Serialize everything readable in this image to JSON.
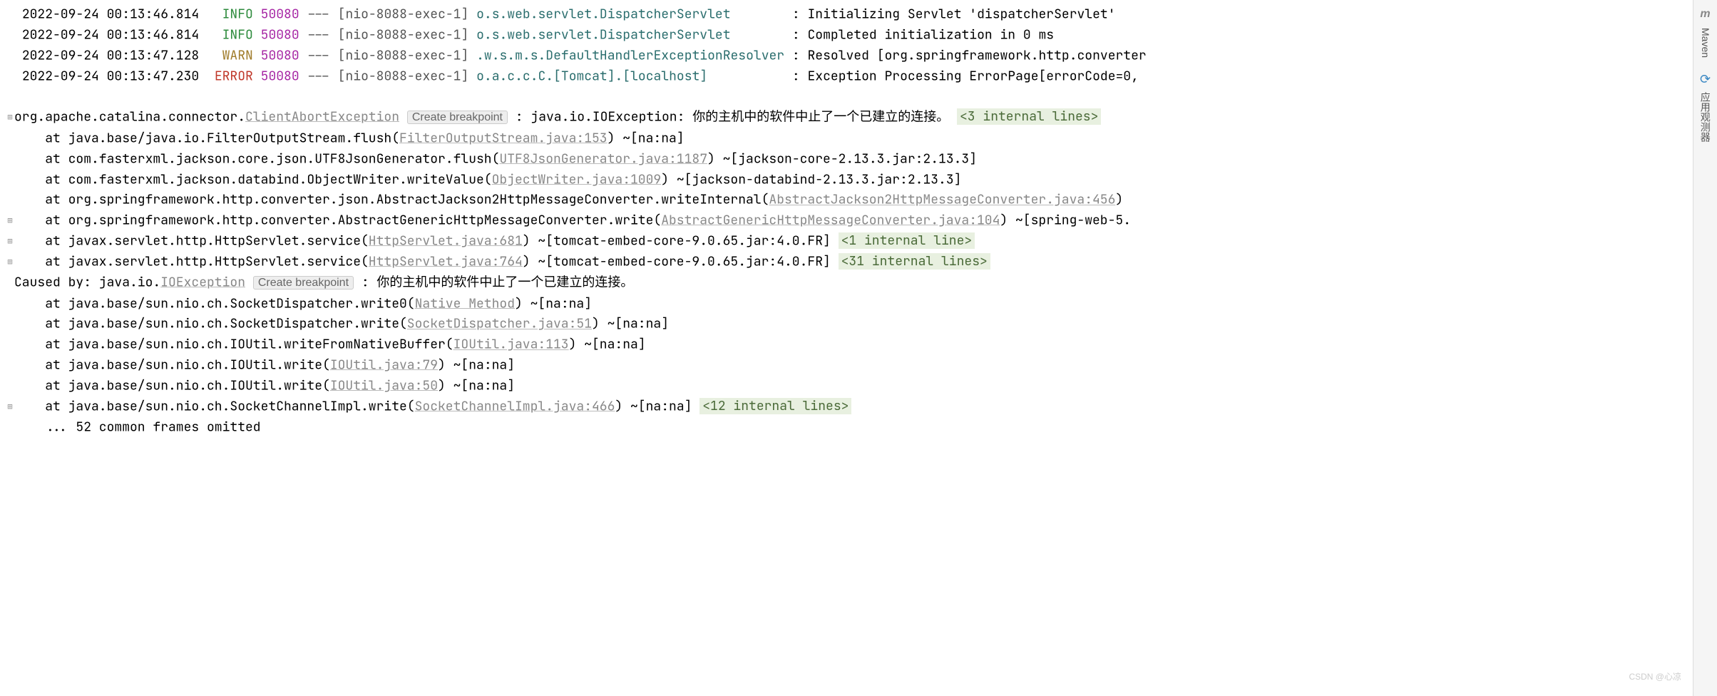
{
  "logs": [
    {
      "ts": "2022-09-24 00:13:46.814",
      "lvl": "INFO",
      "pid": "50080",
      "dash": "---",
      "thread": "[nio-8088-exec-1]",
      "logger": "o.s.web.servlet.DispatcherServlet       ",
      "sep": " :",
      "msg": " Initializing Servlet 'dispatcherServlet'"
    },
    {
      "ts": "2022-09-24 00:13:46.814",
      "lvl": "INFO",
      "pid": "50080",
      "dash": "---",
      "thread": "[nio-8088-exec-1]",
      "logger": "o.s.web.servlet.DispatcherServlet       ",
      "sep": " :",
      "msg": " Completed initialization in 0 ms"
    },
    {
      "ts": "2022-09-24 00:13:47.128",
      "lvl": "WARN",
      "pid": "50080",
      "dash": "---",
      "thread": "[nio-8088-exec-1]",
      "logger": ".w.s.m.s.DefaultHandlerExceptionResolver",
      "sep": " :",
      "msg": " Resolved [org.springframework.http.converter"
    },
    {
      "ts": "2022-09-24 00:13:47.230",
      "lvl": "ERROR",
      "pid": "50080",
      "dash": "---",
      "thread": "[nio-8088-exec-1]",
      "logger": "o.a.c.c.C.[Tomcat].[localhost]          ",
      "sep": " :",
      "msg": " Exception Processing ErrorPage[errorCode=0,"
    }
  ],
  "ex": {
    "head_pre": "org.apache.catalina.connector.",
    "head_link": "ClientAbortException",
    "cb": "Create breakpoint",
    "head_post": " : java.io.IOException: 你的主机中的软件中止了一个已建立的连接。 ",
    "head_fold": "<3 internal lines>",
    "frames": [
      {
        "g": "",
        "pre": "    at java.base/java.io.FilterOutputStream.flush(",
        "link": "FilterOutputStream.java:153",
        "post": ") ~[na:na]"
      },
      {
        "g": "",
        "pre": "    at com.fasterxml.jackson.core.json.UTF8JsonGenerator.flush(",
        "link": "UTF8JsonGenerator.java:1187",
        "post": ") ~[jackson-core-2.13.3.jar:2.13.3]"
      },
      {
        "g": "",
        "pre": "    at com.fasterxml.jackson.databind.ObjectWriter.writeValue(",
        "link": "ObjectWriter.java:1009",
        "post": ") ~[jackson-databind-2.13.3.jar:2.13.3]"
      },
      {
        "g": "",
        "pre": "    at org.springframework.http.converter.json.AbstractJackson2HttpMessageConverter.writeInternal(",
        "link": "AbstractJackson2HttpMessageConverter.java:456",
        "post": ")"
      },
      {
        "g": "⊞",
        "pre": "    at org.springframework.http.converter.AbstractGenericHttpMessageConverter.write(",
        "link": "AbstractGenericHttpMessageConverter.java:104",
        "post": ") ~[spring-web-5."
      },
      {
        "g": "⊞",
        "pre": "    at javax.servlet.http.HttpServlet.service(",
        "link": "HttpServlet.java:681",
        "post": ") ~[tomcat-embed-core-9.0.65.jar:4.0.FR] ",
        "fold": "<1 internal line>"
      },
      {
        "g": "⊞",
        "pre": "    at javax.servlet.http.HttpServlet.service(",
        "link": "HttpServlet.java:764",
        "post": ") ~[tomcat-embed-core-9.0.65.jar:4.0.FR] ",
        "fold": "<31 internal lines>"
      }
    ],
    "cause_pre": "Caused by: java.io.",
    "cause_link": "IOException",
    "cause_post": " : 你的主机中的软件中止了一个已建立的连接。",
    "cframes": [
      {
        "pre": "    at java.base/sun.nio.ch.SocketDispatcher.write0(",
        "link": "Native Method",
        "post": ") ~[na:na]"
      },
      {
        "pre": "    at java.base/sun.nio.ch.SocketDispatcher.write(",
        "link": "SocketDispatcher.java:51",
        "post": ") ~[na:na]"
      },
      {
        "pre": "    at java.base/sun.nio.ch.IOUtil.writeFromNativeBuffer(",
        "link": "IOUtil.java:113",
        "post": ") ~[na:na]"
      },
      {
        "pre": "    at java.base/sun.nio.ch.IOUtil.write(",
        "link": "IOUtil.java:79",
        "post": ") ~[na:na]"
      },
      {
        "pre": "    at java.base/sun.nio.ch.IOUtil.write(",
        "link": "IOUtil.java:50",
        "post": ") ~[na:na]"
      },
      {
        "g": "⊞",
        "pre": "    at java.base/sun.nio.ch.SocketChannelImpl.write(",
        "link": "SocketChannelImpl.java:466",
        "post": ") ~[na:na] ",
        "fold": "<12 internal lines>"
      }
    ],
    "omitted": "    ... 52 common frames omitted"
  },
  "sidebar": {
    "maven": "Maven",
    "observer": "应用观测器"
  },
  "watermark": "CSDN @心凉"
}
